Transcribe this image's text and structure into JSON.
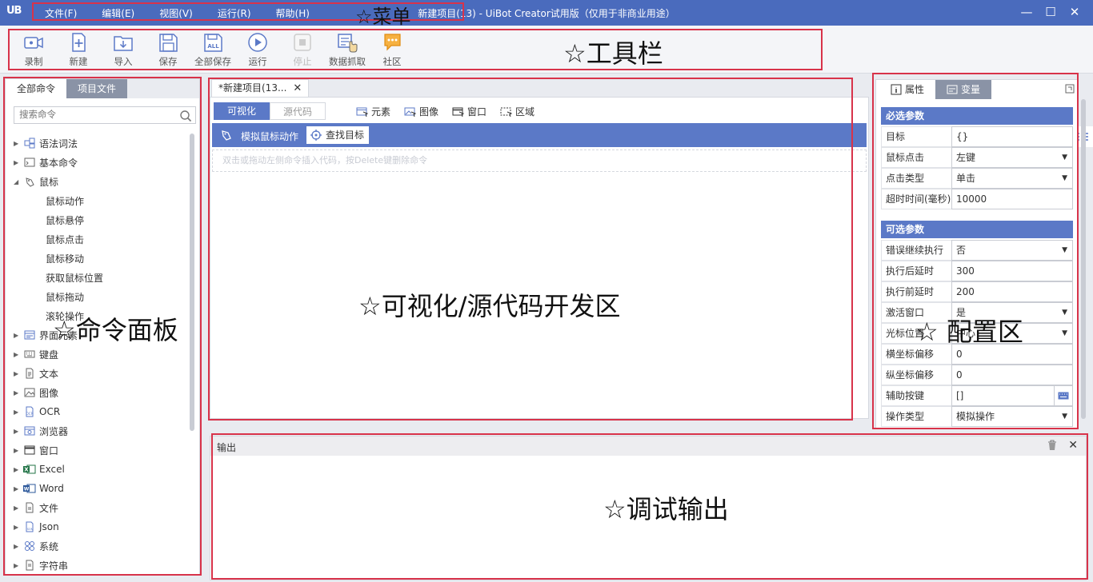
{
  "window": {
    "logo": "UB",
    "title": "新建项目(13) - UiBot Creator试用版（仅用于非商业用途）",
    "menu": [
      "文件(F)",
      "编辑(E)",
      "视图(V)",
      "运行(R)",
      "帮助(H)"
    ]
  },
  "toolbar": {
    "items": [
      {
        "label": "录制",
        "icon": "record-icon"
      },
      {
        "label": "新建",
        "icon": "new-icon"
      },
      {
        "label": "导入",
        "icon": "import-icon"
      },
      {
        "label": "保存",
        "icon": "save-icon"
      },
      {
        "label": "全部保存",
        "icon": "save-all-icon"
      },
      {
        "label": "运行",
        "icon": "run-icon"
      },
      {
        "label": "停止",
        "icon": "stop-icon"
      },
      {
        "label": "数据抓取",
        "icon": "data-scrape-icon"
      },
      {
        "label": "社区",
        "icon": "community-icon"
      }
    ]
  },
  "commands": {
    "tabs": [
      "全部命令",
      "项目文件"
    ],
    "search_placeholder": "搜索命令",
    "tree": [
      {
        "label": "语法词法",
        "icon": "syntax-icon",
        "expanded": false
      },
      {
        "label": "基本命令",
        "icon": "basic-icon",
        "expanded": false
      },
      {
        "label": "鼠标",
        "icon": "mouse-icon",
        "expanded": true,
        "children": [
          "鼠标动作",
          "鼠标悬停",
          "鼠标点击",
          "鼠标移动",
          "获取鼠标位置",
          "鼠标拖动",
          "滚轮操作"
        ]
      },
      {
        "label": "界面元素",
        "icon": "ui-element-icon",
        "expanded": false
      },
      {
        "label": "键盘",
        "icon": "keyboard-icon",
        "expanded": false
      },
      {
        "label": "文本",
        "icon": "text-icon",
        "expanded": false
      },
      {
        "label": "图像",
        "icon": "image-icon",
        "expanded": false
      },
      {
        "label": "OCR",
        "icon": "ocr-icon",
        "expanded": false
      },
      {
        "label": "浏览器",
        "icon": "browser-icon",
        "expanded": false
      },
      {
        "label": "窗口",
        "icon": "window-icon",
        "expanded": false
      },
      {
        "label": "Excel",
        "icon": "excel-icon",
        "expanded": false
      },
      {
        "label": "Word",
        "icon": "word-icon",
        "expanded": false
      },
      {
        "label": "文件",
        "icon": "file-icon",
        "expanded": false
      },
      {
        "label": "Json",
        "icon": "json-icon",
        "expanded": false
      },
      {
        "label": "系统",
        "icon": "system-icon",
        "expanded": false
      },
      {
        "label": "字符串",
        "icon": "string-icon",
        "expanded": false
      }
    ]
  },
  "editor": {
    "tab_title": "*新建项目(13...",
    "modes": [
      "可视化",
      "源代码"
    ],
    "tools": [
      "元素",
      "图像",
      "窗口",
      "区域"
    ],
    "action_title": "模拟鼠标动作",
    "find_target": "查找目标",
    "hint": "双击或拖动左侧命令插入代码，按Delete键删除命令"
  },
  "properties": {
    "tabs": [
      "属性",
      "变量"
    ],
    "required_title": "必选参数",
    "required": [
      {
        "label": "目标",
        "value": "{}",
        "control": "list"
      },
      {
        "label": "鼠标点击",
        "value": "左键",
        "control": "dropdown"
      },
      {
        "label": "点击类型",
        "value": "单击",
        "control": "dropdown"
      },
      {
        "label": "超时时间(毫秒)",
        "value": "10000",
        "control": "text"
      }
    ],
    "optional_title": "可选参数",
    "optional": [
      {
        "label": "错误继续执行",
        "value": "否",
        "control": "dropdown"
      },
      {
        "label": "执行后延时",
        "value": "300",
        "control": "text"
      },
      {
        "label": "执行前延时",
        "value": "200",
        "control": "text"
      },
      {
        "label": "激活窗口",
        "value": "是",
        "control": "dropdown"
      },
      {
        "label": "光标位置",
        "value": "中心",
        "control": "dropdown"
      },
      {
        "label": "横坐标偏移",
        "value": "0",
        "control": "text"
      },
      {
        "label": "纵坐标偏移",
        "value": "0",
        "control": "text"
      },
      {
        "label": "辅助按键",
        "value": "[]",
        "control": "keyboard"
      },
      {
        "label": "操作类型",
        "value": "模拟操作",
        "control": "dropdown"
      }
    ]
  },
  "output": {
    "title": "输出"
  },
  "annotations": {
    "menu": "☆菜单",
    "toolbar": "☆工具栏",
    "command_panel": "☆命令面板",
    "dev_area": "☆可视化/源代码开发区",
    "config": "☆ 配置区",
    "debug": "☆调试输出"
  },
  "colors": {
    "titlebar": "#4a6bbd",
    "accent": "#5b79c7",
    "annotation": "#d8334a"
  }
}
